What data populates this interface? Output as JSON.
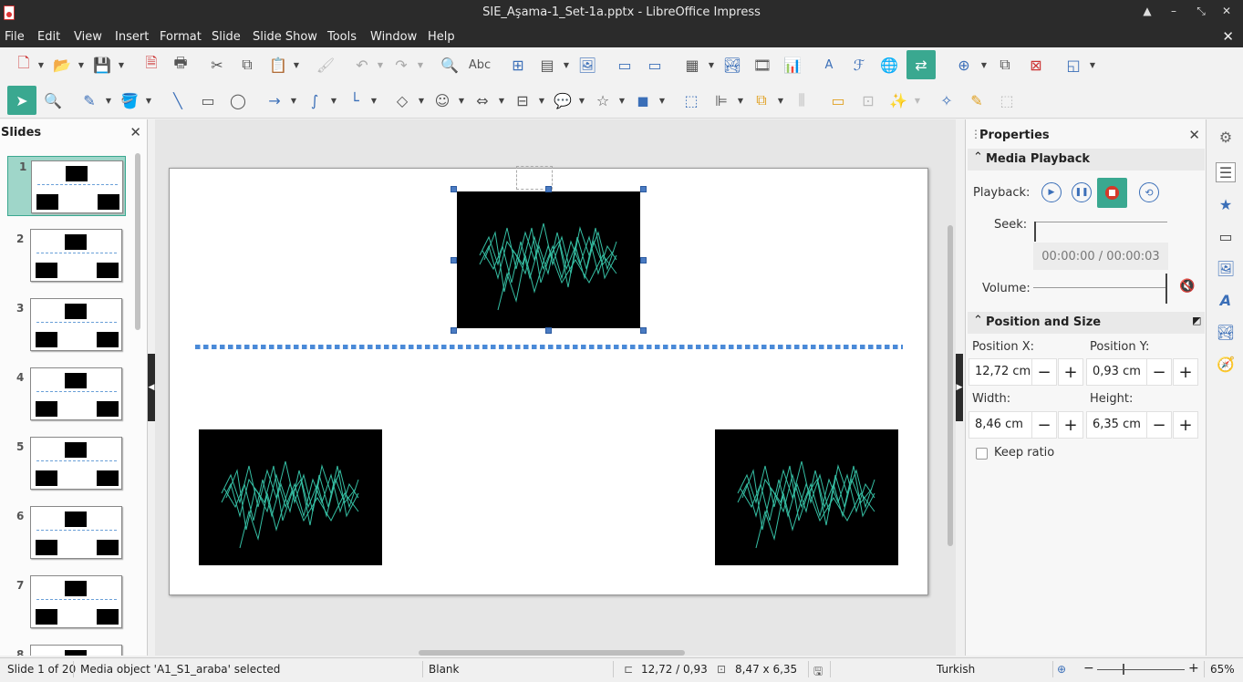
{
  "window": {
    "title": "SIE_Aşama-1_Set-1a.pptx - LibreOffice Impress",
    "controls": [
      "▲",
      "–",
      "⤡",
      "✕"
    ]
  },
  "menubar": {
    "items": [
      "File",
      "Edit",
      "View",
      "Insert",
      "Format",
      "Slide",
      "Slide Show",
      "Tools",
      "Window",
      "Help"
    ],
    "close": "✕"
  },
  "slides_panel": {
    "title": "Slides",
    "close": "✕",
    "slides": [
      {
        "number": "1"
      },
      {
        "number": "2"
      },
      {
        "number": "3"
      },
      {
        "number": "4"
      },
      {
        "number": "5"
      },
      {
        "number": "6"
      },
      {
        "number": "7"
      },
      {
        "number": "8"
      }
    ]
  },
  "properties": {
    "title": "Properties",
    "close": "✕",
    "media_playback": {
      "header": "Media Playback",
      "playback_label": "Playback:",
      "seek_label": "Seek:",
      "time": "00:00:00 / 00:00:03",
      "volume_label": "Volume:"
    },
    "position_size": {
      "header": "Position and Size",
      "pos_x_label": "Position X:",
      "pos_y_label": "Position Y:",
      "pos_x": "12,72 cm",
      "pos_y": "0,93 cm",
      "width_label": "Width:",
      "height_label": "Height:",
      "width": "8,46 cm",
      "height": "6,35 cm",
      "keep_ratio": "Keep ratio",
      "minus": "−",
      "plus": "+"
    }
  },
  "statusbar": {
    "slide": "Slide 1 of 20",
    "selection": "Media object 'A1_S1_araba' selected",
    "layout": "Blank",
    "position": "12,72 / 0,93",
    "size": "8,47 x 6,35",
    "language": "Turkish",
    "zoom": "65%"
  },
  "colors": {
    "accent": "#3aa890",
    "wave": "#3fe0c0",
    "dark_bar": "#2b2b2b"
  }
}
